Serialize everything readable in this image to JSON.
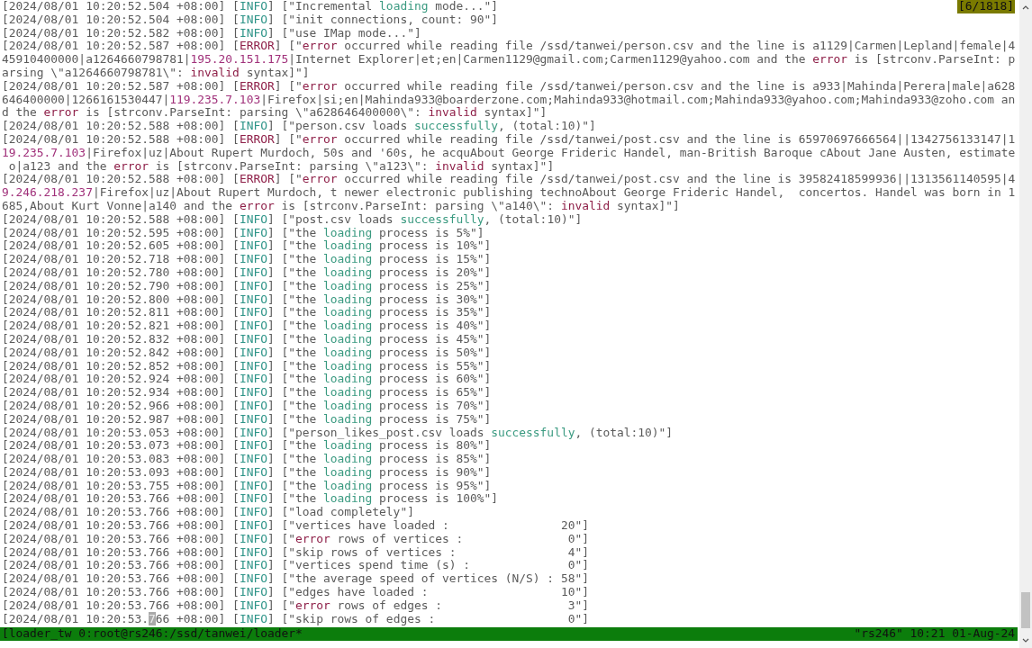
{
  "scroll_position": "[6/1818]",
  "lines": [
    {
      "segments": [
        {
          "text": "[2024/08/01 10:20:52.504 +08:00] [",
          "kind": "plain"
        },
        {
          "text": "INFO",
          "kind": "info"
        },
        {
          "text": "] [\"Incremental ",
          "kind": "plain"
        },
        {
          "text": "loading",
          "kind": "keyword"
        },
        {
          "text": " mode...\"]",
          "kind": "plain"
        }
      ]
    },
    {
      "segments": [
        {
          "text": "[2024/08/01 10:20:52.504 +08:00] [",
          "kind": "plain"
        },
        {
          "text": "INFO",
          "kind": "info"
        },
        {
          "text": "] [\"init connections, count: 90\"]",
          "kind": "plain"
        }
      ]
    },
    {
      "segments": [
        {
          "text": "[2024/08/01 10:20:52.582 +08:00] [",
          "kind": "plain"
        },
        {
          "text": "INFO",
          "kind": "info"
        },
        {
          "text": "] [\"use IMap mode...\"]",
          "kind": "plain"
        }
      ]
    },
    {
      "segments": [
        {
          "text": "[2024/08/01 10:20:52.587 +08:00] [",
          "kind": "plain"
        },
        {
          "text": "ERROR",
          "kind": "error"
        },
        {
          "text": "] [\"",
          "kind": "plain"
        },
        {
          "text": "error",
          "kind": "error"
        },
        {
          "text": " occurred while reading file /ssd/tanwei/person.csv and the line is a1129|Carmen|Lepland|female|4",
          "kind": "plain"
        }
      ]
    },
    {
      "segments": [
        {
          "text": "45910400000|a1264660798781|",
          "kind": "plain"
        },
        {
          "text": "195.20.151.175",
          "kind": "address"
        },
        {
          "text": "|Internet Explorer|et;en|Carmen1129@gmail.com;Carmen1129@yahoo.com and the ",
          "kind": "plain"
        },
        {
          "text": "error",
          "kind": "error"
        },
        {
          "text": " is [strconv.ParseInt: p",
          "kind": "plain"
        }
      ]
    },
    {
      "segments": [
        {
          "text": "arsing \\\"a1264660798781\\\": ",
          "kind": "plain"
        },
        {
          "text": "invalid",
          "kind": "error"
        },
        {
          "text": " syntax]\"]",
          "kind": "plain"
        }
      ]
    },
    {
      "segments": [
        {
          "text": "[2024/08/01 10:20:52.587 +08:00] [",
          "kind": "plain"
        },
        {
          "text": "ERROR",
          "kind": "error"
        },
        {
          "text": "] [\"",
          "kind": "plain"
        },
        {
          "text": "error",
          "kind": "error"
        },
        {
          "text": " occurred while reading file /ssd/tanwei/person.csv and the line is a933|Mahinda|Perera|male|a628",
          "kind": "plain"
        }
      ]
    },
    {
      "segments": [
        {
          "text": "646400000|1266161530447|",
          "kind": "plain"
        },
        {
          "text": "119.235.7.103",
          "kind": "address"
        },
        {
          "text": "|Firefox|si;en|Mahinda933@boarderzone.com;Mahinda933@hotmail.com;Mahinda933@yahoo.com;Mahinda933@zoho.com an",
          "kind": "plain"
        }
      ]
    },
    {
      "segments": [
        {
          "text": "d the ",
          "kind": "plain"
        },
        {
          "text": "error",
          "kind": "error"
        },
        {
          "text": " is [strconv.ParseInt: parsing \\\"a628646400000\\\": ",
          "kind": "plain"
        },
        {
          "text": "invalid",
          "kind": "error"
        },
        {
          "text": " syntax]\"]",
          "kind": "plain"
        }
      ]
    },
    {
      "segments": [
        {
          "text": "[2024/08/01 10:20:52.588 +08:00] [",
          "kind": "plain"
        },
        {
          "text": "INFO",
          "kind": "info"
        },
        {
          "text": "] [\"person.csv loads ",
          "kind": "plain"
        },
        {
          "text": "successfully",
          "kind": "keyword"
        },
        {
          "text": ", (total:10)\"]",
          "kind": "plain"
        }
      ]
    },
    {
      "segments": [
        {
          "text": "[2024/08/01 10:20:52.588 +08:00] [",
          "kind": "plain"
        },
        {
          "text": "ERROR",
          "kind": "error"
        },
        {
          "text": "] [\"",
          "kind": "plain"
        },
        {
          "text": "error",
          "kind": "error"
        },
        {
          "text": " occurred while reading file /ssd/tanwei/post.csv and the line is 65970697666564||1342756133147|1",
          "kind": "plain"
        }
      ]
    },
    {
      "segments": [
        {
          "text": "19.235.7.103",
          "kind": "address"
        },
        {
          "text": "|Firefox|uz|About Rupert Murdoch, 50s and '60s, he acquAbout George Frideric Handel, man-British Baroque cAbout Jane Austen, estimate",
          "kind": "plain"
        }
      ]
    },
    {
      "segments": [
        {
          "text": " o|a123 and the ",
          "kind": "plain"
        },
        {
          "text": "error",
          "kind": "error"
        },
        {
          "text": " is [strconv.ParseInt: parsing \\\"a123\\\": ",
          "kind": "plain"
        },
        {
          "text": "invalid",
          "kind": "error"
        },
        {
          "text": " syntax]\"]",
          "kind": "plain"
        }
      ]
    },
    {
      "segments": [
        {
          "text": "[2024/08/01 10:20:52.588 +08:00] [",
          "kind": "plain"
        },
        {
          "text": "ERROR",
          "kind": "error"
        },
        {
          "text": "] [\"",
          "kind": "plain"
        },
        {
          "text": "error",
          "kind": "error"
        },
        {
          "text": " occurred while reading file /ssd/tanwei/post.csv and the line is 39582418599936||1313561140595|4",
          "kind": "plain"
        }
      ]
    },
    {
      "segments": [
        {
          "text": "9.246.218.237",
          "kind": "address"
        },
        {
          "text": "|Firefox|uz|About Rupert Murdoch, t newer electronic publishing technoAbout George Frideric Handel,  concertos. Handel was born in 1",
          "kind": "plain"
        }
      ]
    },
    {
      "segments": [
        {
          "text": "685,About Kurt Vonne|a140 and the ",
          "kind": "plain"
        },
        {
          "text": "error",
          "kind": "error"
        },
        {
          "text": " is [strconv.ParseInt: parsing \\\"a140\\\": ",
          "kind": "plain"
        },
        {
          "text": "invalid",
          "kind": "error"
        },
        {
          "text": " syntax]\"]",
          "kind": "plain"
        }
      ]
    },
    {
      "segments": [
        {
          "text": "[2024/08/01 10:20:52.588 +08:00] [",
          "kind": "plain"
        },
        {
          "text": "INFO",
          "kind": "info"
        },
        {
          "text": "] [\"post.csv loads ",
          "kind": "plain"
        },
        {
          "text": "successfully",
          "kind": "keyword"
        },
        {
          "text": ", (total:10)\"]",
          "kind": "plain"
        }
      ]
    },
    {
      "segments": [
        {
          "text": "[2024/08/01 10:20:52.595 +08:00] [",
          "kind": "plain"
        },
        {
          "text": "INFO",
          "kind": "info"
        },
        {
          "text": "] [\"the ",
          "kind": "plain"
        },
        {
          "text": "loading",
          "kind": "keyword"
        },
        {
          "text": " process is 5%\"]",
          "kind": "plain"
        }
      ]
    },
    {
      "segments": [
        {
          "text": "[2024/08/01 10:20:52.605 +08:00] [",
          "kind": "plain"
        },
        {
          "text": "INFO",
          "kind": "info"
        },
        {
          "text": "] [\"the ",
          "kind": "plain"
        },
        {
          "text": "loading",
          "kind": "keyword"
        },
        {
          "text": " process is 10%\"]",
          "kind": "plain"
        }
      ]
    },
    {
      "segments": [
        {
          "text": "[2024/08/01 10:20:52.718 +08:00] [",
          "kind": "plain"
        },
        {
          "text": "INFO",
          "kind": "info"
        },
        {
          "text": "] [\"the ",
          "kind": "plain"
        },
        {
          "text": "loading",
          "kind": "keyword"
        },
        {
          "text": " process is 15%\"]",
          "kind": "plain"
        }
      ]
    },
    {
      "segments": [
        {
          "text": "[2024/08/01 10:20:52.780 +08:00] [",
          "kind": "plain"
        },
        {
          "text": "INFO",
          "kind": "info"
        },
        {
          "text": "] [\"the ",
          "kind": "plain"
        },
        {
          "text": "loading",
          "kind": "keyword"
        },
        {
          "text": " process is 20%\"]",
          "kind": "plain"
        }
      ]
    },
    {
      "segments": [
        {
          "text": "[2024/08/01 10:20:52.790 +08:00] [",
          "kind": "plain"
        },
        {
          "text": "INFO",
          "kind": "info"
        },
        {
          "text": "] [\"the ",
          "kind": "plain"
        },
        {
          "text": "loading",
          "kind": "keyword"
        },
        {
          "text": " process is 25%\"]",
          "kind": "plain"
        }
      ]
    },
    {
      "segments": [
        {
          "text": "[2024/08/01 10:20:52.800 +08:00] [",
          "kind": "plain"
        },
        {
          "text": "INFO",
          "kind": "info"
        },
        {
          "text": "] [\"the ",
          "kind": "plain"
        },
        {
          "text": "loading",
          "kind": "keyword"
        },
        {
          "text": " process is 30%\"]",
          "kind": "plain"
        }
      ]
    },
    {
      "segments": [
        {
          "text": "[2024/08/01 10:20:52.811 +08:00] [",
          "kind": "plain"
        },
        {
          "text": "INFO",
          "kind": "info"
        },
        {
          "text": "] [\"the ",
          "kind": "plain"
        },
        {
          "text": "loading",
          "kind": "keyword"
        },
        {
          "text": " process is 35%\"]",
          "kind": "plain"
        }
      ]
    },
    {
      "segments": [
        {
          "text": "[2024/08/01 10:20:52.821 +08:00] [",
          "kind": "plain"
        },
        {
          "text": "INFO",
          "kind": "info"
        },
        {
          "text": "] [\"the ",
          "kind": "plain"
        },
        {
          "text": "loading",
          "kind": "keyword"
        },
        {
          "text": " process is 40%\"]",
          "kind": "plain"
        }
      ]
    },
    {
      "segments": [
        {
          "text": "[2024/08/01 10:20:52.832 +08:00] [",
          "kind": "plain"
        },
        {
          "text": "INFO",
          "kind": "info"
        },
        {
          "text": "] [\"the ",
          "kind": "plain"
        },
        {
          "text": "loading",
          "kind": "keyword"
        },
        {
          "text": " process is 45%\"]",
          "kind": "plain"
        }
      ]
    },
    {
      "segments": [
        {
          "text": "[2024/08/01 10:20:52.842 +08:00] [",
          "kind": "plain"
        },
        {
          "text": "INFO",
          "kind": "info"
        },
        {
          "text": "] [\"the ",
          "kind": "plain"
        },
        {
          "text": "loading",
          "kind": "keyword"
        },
        {
          "text": " process is 50%\"]",
          "kind": "plain"
        }
      ]
    },
    {
      "segments": [
        {
          "text": "[2024/08/01 10:20:52.852 +08:00] [",
          "kind": "plain"
        },
        {
          "text": "INFO",
          "kind": "info"
        },
        {
          "text": "] [\"the ",
          "kind": "plain"
        },
        {
          "text": "loading",
          "kind": "keyword"
        },
        {
          "text": " process is 55%\"]",
          "kind": "plain"
        }
      ]
    },
    {
      "segments": [
        {
          "text": "[2024/08/01 10:20:52.924 +08:00] [",
          "kind": "plain"
        },
        {
          "text": "INFO",
          "kind": "info"
        },
        {
          "text": "] [\"the ",
          "kind": "plain"
        },
        {
          "text": "loading",
          "kind": "keyword"
        },
        {
          "text": " process is 60%\"]",
          "kind": "plain"
        }
      ]
    },
    {
      "segments": [
        {
          "text": "[2024/08/01 10:20:52.934 +08:00] [",
          "kind": "plain"
        },
        {
          "text": "INFO",
          "kind": "info"
        },
        {
          "text": "] [\"the ",
          "kind": "plain"
        },
        {
          "text": "loading",
          "kind": "keyword"
        },
        {
          "text": " process is 65%\"]",
          "kind": "plain"
        }
      ]
    },
    {
      "segments": [
        {
          "text": "[2024/08/01 10:20:52.966 +08:00] [",
          "kind": "plain"
        },
        {
          "text": "INFO",
          "kind": "info"
        },
        {
          "text": "] [\"the ",
          "kind": "plain"
        },
        {
          "text": "loading",
          "kind": "keyword"
        },
        {
          "text": " process is 70%\"]",
          "kind": "plain"
        }
      ]
    },
    {
      "segments": [
        {
          "text": "[2024/08/01 10:20:52.987 +08:00] [",
          "kind": "plain"
        },
        {
          "text": "INFO",
          "kind": "info"
        },
        {
          "text": "] [\"the ",
          "kind": "plain"
        },
        {
          "text": "loading",
          "kind": "keyword"
        },
        {
          "text": " process is 75%\"]",
          "kind": "plain"
        }
      ]
    },
    {
      "segments": [
        {
          "text": "[2024/08/01 10:20:53.053 +08:00] [",
          "kind": "plain"
        },
        {
          "text": "INFO",
          "kind": "info"
        },
        {
          "text": "] [\"person_likes_post.csv loads ",
          "kind": "plain"
        },
        {
          "text": "successfully",
          "kind": "keyword"
        },
        {
          "text": ", (total:10)\"]",
          "kind": "plain"
        }
      ]
    },
    {
      "segments": [
        {
          "text": "[2024/08/01 10:20:53.073 +08:00] [",
          "kind": "plain"
        },
        {
          "text": "INFO",
          "kind": "info"
        },
        {
          "text": "] [\"the ",
          "kind": "plain"
        },
        {
          "text": "loading",
          "kind": "keyword"
        },
        {
          "text": " process is 80%\"]",
          "kind": "plain"
        }
      ]
    },
    {
      "segments": [
        {
          "text": "[2024/08/01 10:20:53.083 +08:00] [",
          "kind": "plain"
        },
        {
          "text": "INFO",
          "kind": "info"
        },
        {
          "text": "] [\"the ",
          "kind": "plain"
        },
        {
          "text": "loading",
          "kind": "keyword"
        },
        {
          "text": " process is 85%\"]",
          "kind": "plain"
        }
      ]
    },
    {
      "segments": [
        {
          "text": "[2024/08/01 10:20:53.093 +08:00] [",
          "kind": "plain"
        },
        {
          "text": "INFO",
          "kind": "info"
        },
        {
          "text": "] [\"the ",
          "kind": "plain"
        },
        {
          "text": "loading",
          "kind": "keyword"
        },
        {
          "text": " process is 90%\"]",
          "kind": "plain"
        }
      ]
    },
    {
      "segments": [
        {
          "text": "[2024/08/01 10:20:53.755 +08:00] [",
          "kind": "plain"
        },
        {
          "text": "INFO",
          "kind": "info"
        },
        {
          "text": "] [\"the ",
          "kind": "plain"
        },
        {
          "text": "loading",
          "kind": "keyword"
        },
        {
          "text": " process is 95%\"]",
          "kind": "plain"
        }
      ]
    },
    {
      "segments": [
        {
          "text": "[2024/08/01 10:20:53.766 +08:00] [",
          "kind": "plain"
        },
        {
          "text": "INFO",
          "kind": "info"
        },
        {
          "text": "] [\"the ",
          "kind": "plain"
        },
        {
          "text": "loading",
          "kind": "keyword"
        },
        {
          "text": " process is 100%\"]",
          "kind": "plain"
        }
      ]
    },
    {
      "segments": [
        {
          "text": "[2024/08/01 10:20:53.766 +08:00] [",
          "kind": "plain"
        },
        {
          "text": "INFO",
          "kind": "info"
        },
        {
          "text": "] [\"load completely\"]",
          "kind": "plain"
        }
      ]
    },
    {
      "segments": [
        {
          "text": "[2024/08/01 10:20:53.766 +08:00] [",
          "kind": "plain"
        },
        {
          "text": "INFO",
          "kind": "info"
        },
        {
          "text": "] [\"vertices have loaded :                20\"]",
          "kind": "plain"
        }
      ]
    },
    {
      "segments": [
        {
          "text": "[2024/08/01 10:20:53.766 +08:00] [",
          "kind": "plain"
        },
        {
          "text": "INFO",
          "kind": "info"
        },
        {
          "text": "] [\"",
          "kind": "plain"
        },
        {
          "text": "error",
          "kind": "error"
        },
        {
          "text": " rows of vertices :               0\"]",
          "kind": "plain"
        }
      ]
    },
    {
      "segments": [
        {
          "text": "[2024/08/01 10:20:53.766 +08:00] [",
          "kind": "plain"
        },
        {
          "text": "INFO",
          "kind": "info"
        },
        {
          "text": "] [\"skip rows of vertices :                4\"]",
          "kind": "plain"
        }
      ]
    },
    {
      "segments": [
        {
          "text": "[2024/08/01 10:20:53.766 +08:00] [",
          "kind": "plain"
        },
        {
          "text": "INFO",
          "kind": "info"
        },
        {
          "text": "] [\"vertices spend time (s) :              0\"]",
          "kind": "plain"
        }
      ]
    },
    {
      "segments": [
        {
          "text": "[2024/08/01 10:20:53.766 +08:00] [",
          "kind": "plain"
        },
        {
          "text": "INFO",
          "kind": "info"
        },
        {
          "text": "] [\"the average speed of vertices (N/S) : 58\"]",
          "kind": "plain"
        }
      ]
    },
    {
      "segments": [
        {
          "text": "[2024/08/01 10:20:53.766 +08:00] [",
          "kind": "plain"
        },
        {
          "text": "INFO",
          "kind": "info"
        },
        {
          "text": "] [\"edges have loaded :                   10\"]",
          "kind": "plain"
        }
      ]
    },
    {
      "segments": [
        {
          "text": "[2024/08/01 10:20:53.766 +08:00] [",
          "kind": "plain"
        },
        {
          "text": "INFO",
          "kind": "info"
        },
        {
          "text": "] [\"",
          "kind": "plain"
        },
        {
          "text": "error",
          "kind": "error"
        },
        {
          "text": " rows of edges :                  3\"]",
          "kind": "plain"
        }
      ]
    },
    {
      "segments": [
        {
          "text": "[2024/08/01 10:20:53.",
          "kind": "plain"
        },
        {
          "text": "7",
          "kind": "cursor"
        },
        {
          "text": "66 +08:00] [",
          "kind": "plain"
        },
        {
          "text": "INFO",
          "kind": "info"
        },
        {
          "text": "] [\"skip rows of edges :                   0\"]",
          "kind": "plain"
        }
      ]
    }
  ],
  "status_bar": {
    "session": "[loader_tw 0:root@rs246:/ssd/tanwei/loader*",
    "host_clock": "\"rs246\" 10:21 01-Aug-24"
  }
}
